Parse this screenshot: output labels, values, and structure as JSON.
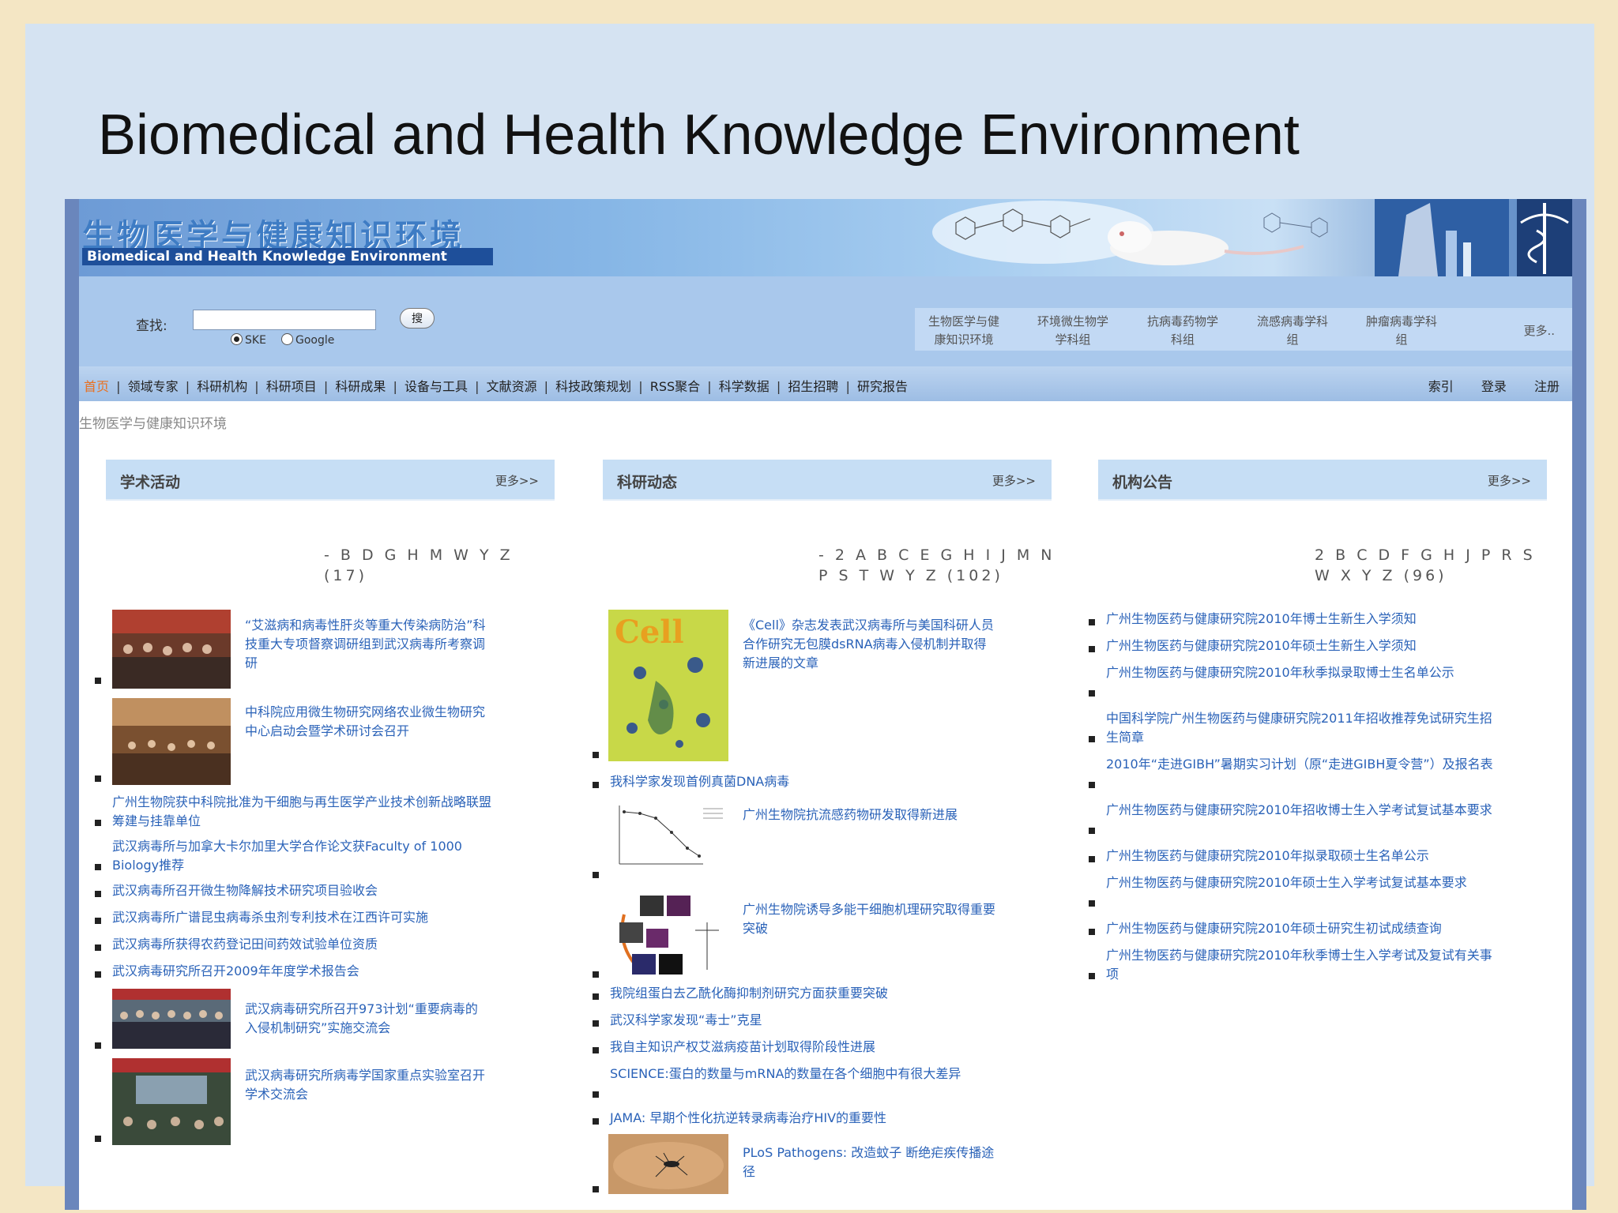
{
  "slide": {
    "title": "Biomedical and Health Knowledge Environment"
  },
  "banner": {
    "logo_cn": "生物医学与健康知识环境",
    "logo_en": "Biomedical and Health Knowledge Environment"
  },
  "search": {
    "label": "查找:",
    "input_value": "",
    "button_label": "搜",
    "options": [
      {
        "label": "SKE",
        "selected": true
      },
      {
        "label": "Google",
        "selected": false
      }
    ]
  },
  "groups": {
    "items": [
      {
        "line1": "生物医学与健",
        "line2": "康知识环境"
      },
      {
        "line1": "环境微生物学",
        "line2": "学科组"
      },
      {
        "line1": "抗病毒药物学",
        "line2": "科组"
      },
      {
        "line1": "流感病毒学科",
        "line2": "组"
      },
      {
        "line1": "肿瘤病毒学科",
        "line2": "组"
      }
    ],
    "more": "更多.."
  },
  "nav": {
    "items": [
      "首页",
      "领域专家",
      "科研机构",
      "科研项目",
      "科研成果",
      "设备与工具",
      "文献资源",
      "科技政策规划",
      "RSS聚合",
      "科学数据",
      "招生招聘",
      "研究报告"
    ],
    "separator": "|",
    "right": [
      "索引",
      "登录",
      "注册"
    ]
  },
  "breadcrumb": "生物医学与健康知识环境",
  "panels": [
    {
      "title": "学术活动",
      "more": "更多>>",
      "alpha_line1": "- B D G H M W Y Z",
      "alpha_line2": "(17)",
      "items": [
        {
          "text": "“艾滋病和病毒性肝炎等重大传染病防治”科技重大专项督察调研组到武汉病毒所考察调研",
          "thumb": "meeting-photo"
        },
        {
          "text": "中科院应用微生物研究网络农业微生物研究中心启动会暨学术研讨会召开",
          "thumb": "conference-photo"
        },
        {
          "text": "广州生物院获中科院批准为干细胞与再生医学产业技术创新战略联盟筹建与挂靠单位"
        },
        {
          "text": "武汉病毒所与加拿大卡尔加里大学合作论文获Faculty of 1000 Biology推荐"
        },
        {
          "text": "武汉病毒所召开微生物降解技术研究项目验收会"
        },
        {
          "text": "武汉病毒所广谱昆虫病毒杀虫剂专利技术在江西许可实施"
        },
        {
          "text": "武汉病毒所获得农药登记田间药效试验单位资质"
        },
        {
          "text": "武汉病毒研究所召开2009年年度学术报告会"
        },
        {
          "text": "武汉病毒研究所召开973计划“重要病毒的入侵机制研究”实施交流会",
          "thumb": "group-photo"
        },
        {
          "text": "武汉病毒研究所病毒学国家重点实验室召开学术交流会",
          "thumb": "lecture-photo"
        }
      ]
    },
    {
      "title": "科研动态",
      "more": "更多>>",
      "alpha_line1": "- 2 A B C E G H I J M N",
      "alpha_line2": "P S T W Y Z (102)",
      "items": [
        {
          "text": "《Cell》杂志发表武汉病毒所与美国科研人员合作研究无包膜dsRNA病毒入侵机制并取得新进展的文章",
          "thumb": "cell-journal-cover"
        },
        {
          "text": "我科学家发现首例真菌DNA病毒"
        },
        {
          "text": "广州生物院抗流感药物研发取得新进展",
          "thumb": "dose-response-chart"
        },
        {
          "text": "广州生物院诱导多能干细胞机理研究取得重要突破",
          "thumb": "stem-cell-diagram"
        },
        {
          "text": "我院组蛋白去乙酰化酶抑制剂研究方面获重要突破"
        },
        {
          "text": "武汉科学家发现“毒士”克星"
        },
        {
          "text": "我自主知识产权艾滋病疫苗计划取得阶段性进展"
        },
        {
          "text": "SCIENCE:蛋白的数量与mRNA的数量在各个细胞中有很大差异"
        },
        {
          "text": "JAMA: 早期个性化抗逆转录病毒治疗HIV的重要性"
        },
        {
          "text": "PLoS Pathogens: 改造蚊子 断绝疟疾传播途径",
          "thumb": "mosquito-photo"
        }
      ]
    },
    {
      "title": "机构公告",
      "more": "更多>>",
      "alpha_line1": "2 B C D F G H J P R S",
      "alpha_line2": "W X Y Z (96)",
      "items": [
        {
          "text": "广州生物医药与健康研究院2010年博士生新生入学须知"
        },
        {
          "text": "广州生物医药与健康研究院2010年硕士生新生入学须知"
        },
        {
          "text": "广州生物医药与健康研究院2010年秋季拟录取博士生名单公示"
        },
        {
          "text": "中国科学院广州生物医药与健康研究院2011年招收推荐免试研究生招生简章"
        },
        {
          "text": "2010年“走进GIBH”暑期实习计划（原“走进GIBH夏令营”）及报名表"
        },
        {
          "text": "广州生物医药与健康研究院2010年招收博士生入学考试复试基本要求"
        },
        {
          "text": "广州生物医药与健康研究院2010年拟录取硕士生名单公示"
        },
        {
          "text": "广州生物医药与健康研究院2010年硕士生入学考试复试基本要求"
        },
        {
          "text": "广州生物医药与健康研究院2010年硕士研究生初试成绩查询"
        },
        {
          "text": "广州生物医药与健康研究院2010年秋季博士生入学考试及复试有关事项"
        }
      ]
    }
  ]
}
